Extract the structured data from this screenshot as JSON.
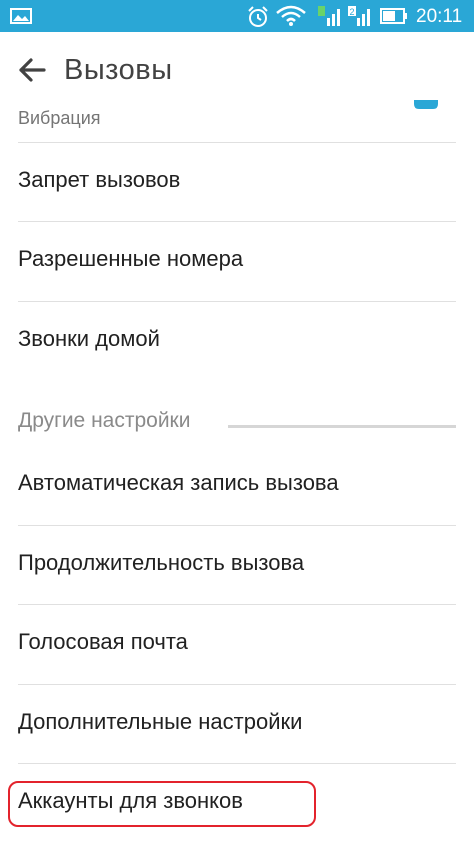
{
  "status_bar": {
    "time": "20:11",
    "bg_color": "#2aa7d6",
    "icons": [
      "gallery-icon",
      "alarm-icon",
      "wifi-icon",
      "sim1-signal-icon",
      "sim2-signal-icon",
      "battery-icon"
    ]
  },
  "app_bar": {
    "title": "Вызовы",
    "back_icon": "arrow-back-icon"
  },
  "partial_item": {
    "label": "Вибрация",
    "toggle_color": "#2aa7d6"
  },
  "items_group1": [
    {
      "label": "Запрет вызовов"
    },
    {
      "label": "Разрешенные номера"
    },
    {
      "label": "Звонки домой"
    }
  ],
  "section": {
    "title": "Другие настройки"
  },
  "items_group2": [
    {
      "label": "Автоматическая запись вызова"
    },
    {
      "label": "Продолжительность вызова"
    },
    {
      "label": "Голосовая почта"
    },
    {
      "label": "Дополнительные настройки"
    },
    {
      "label": "Аккаунты для звонков"
    }
  ],
  "highlight": {
    "color": "#e3232c",
    "target": "Аккаунты для звонков"
  }
}
